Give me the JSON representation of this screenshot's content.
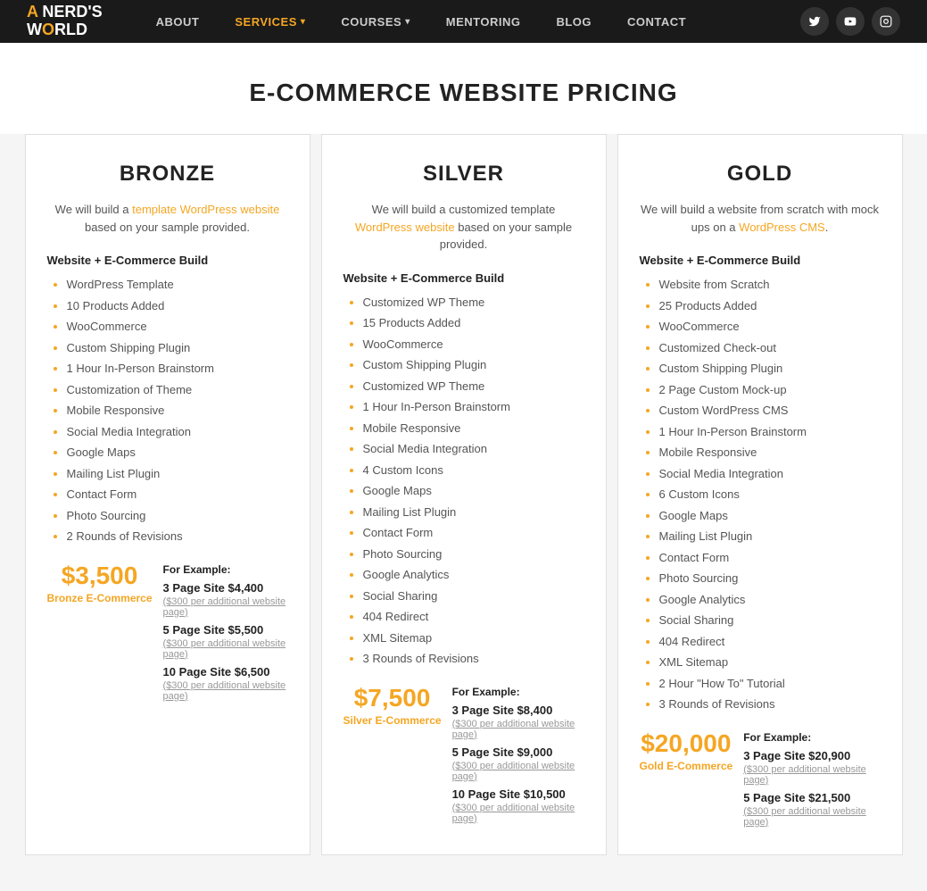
{
  "nav": {
    "logo_line1": "A NERD'S",
    "logo_line2": "WORLD",
    "links": [
      {
        "label": "ABOUT",
        "active": false
      },
      {
        "label": "SERVICES",
        "active": true,
        "arrow": "▾"
      },
      {
        "label": "COURSES",
        "active": false,
        "arrow": "▾"
      },
      {
        "label": "MENTORING",
        "active": false
      },
      {
        "label": "BLOG",
        "active": false
      },
      {
        "label": "CONTACT",
        "active": false
      }
    ],
    "icons": [
      "𝕏",
      "▶",
      "📷"
    ]
  },
  "page": {
    "title": "E-COMMERCE WEBSITE PRICING"
  },
  "tiers": [
    {
      "id": "bronze",
      "title": "BRONZE",
      "desc_parts": [
        "We will build a template WordPress website based on your sample provided."
      ],
      "section_label": "Website + E-Commerce Build",
      "features": [
        "WordPress Template",
        "10 Products Added",
        "WooCommerce",
        "Custom Shipping Plugin",
        "1 Hour In-Person Brainstorm",
        "Customization of Theme",
        "Mobile Responsive",
        "Social Media Integration",
        "Google Maps",
        "Mailing List Plugin",
        "Contact Form",
        "Photo Sourcing",
        "2 Rounds of Revisions"
      ],
      "price": "$3,500",
      "price_label": "Bronze E-Commerce",
      "example_label": "For Example:",
      "examples": [
        {
          "item": "3 Page Site $4,400",
          "sub": "($300 per additional website page)"
        },
        {
          "item": "5 Page Site $5,500",
          "sub": "($300 per additional website page)"
        },
        {
          "item": "10 Page Site $6,500",
          "sub": "($300 per additional website page)"
        }
      ]
    },
    {
      "id": "silver",
      "title": "SILVER",
      "desc_parts": [
        "We will build a customized template WordPress website based on your sample provided."
      ],
      "section_label": "Website + E-Commerce Build",
      "features": [
        "Customized WP Theme",
        "15 Products Added",
        "WooCommerce",
        "Custom Shipping Plugin",
        "Customized WP Theme",
        "1 Hour In-Person Brainstorm",
        "Mobile Responsive",
        "Social Media Integration",
        "4 Custom Icons",
        "Google Maps",
        "Mailing List Plugin",
        "Contact Form",
        "Photo Sourcing",
        "Google Analytics",
        "Social Sharing",
        "404 Redirect",
        "XML Sitemap",
        "3 Rounds of Revisions"
      ],
      "price": "$7,500",
      "price_label": "Silver E-Commerce",
      "example_label": "For Example:",
      "examples": [
        {
          "item": "3 Page Site $8,400",
          "sub": "($300 per additional website page)"
        },
        {
          "item": "5 Page Site $9,000",
          "sub": "($300 per additional website page)"
        },
        {
          "item": "10 Page Site $10,500",
          "sub": "($300 per additional website page)"
        }
      ]
    },
    {
      "id": "gold",
      "title": "GOLD",
      "desc_parts": [
        "We will build a website from scratch with mock ups on a WordPress CMS."
      ],
      "section_label": "Website + E-Commerce Build",
      "features": [
        "Website from Scratch",
        "25 Products Added",
        "WooCommerce",
        "Customized Check-out",
        "Custom Shipping Plugin",
        "2 Page Custom Mock-up",
        "Custom WordPress CMS",
        "1 Hour In-Person Brainstorm",
        "Mobile Responsive",
        "Social Media Integration",
        "6 Custom Icons",
        "Google Maps",
        "Mailing List Plugin",
        "Contact Form",
        "Photo Sourcing",
        "Google Analytics",
        "Social Sharing",
        "404 Redirect",
        "XML Sitemap",
        "2 Hour \"How To\" Tutorial",
        "3 Rounds of Revisions"
      ],
      "price": "$20,000",
      "price_label": "Gold E-Commerce",
      "example_label": "For Example:",
      "examples": [
        {
          "item": "3 Page Site $20,900",
          "sub": "($300 per additional website page)"
        },
        {
          "item": "5 Page Site $21,500",
          "sub": "($300 per additional website page)"
        }
      ]
    }
  ]
}
